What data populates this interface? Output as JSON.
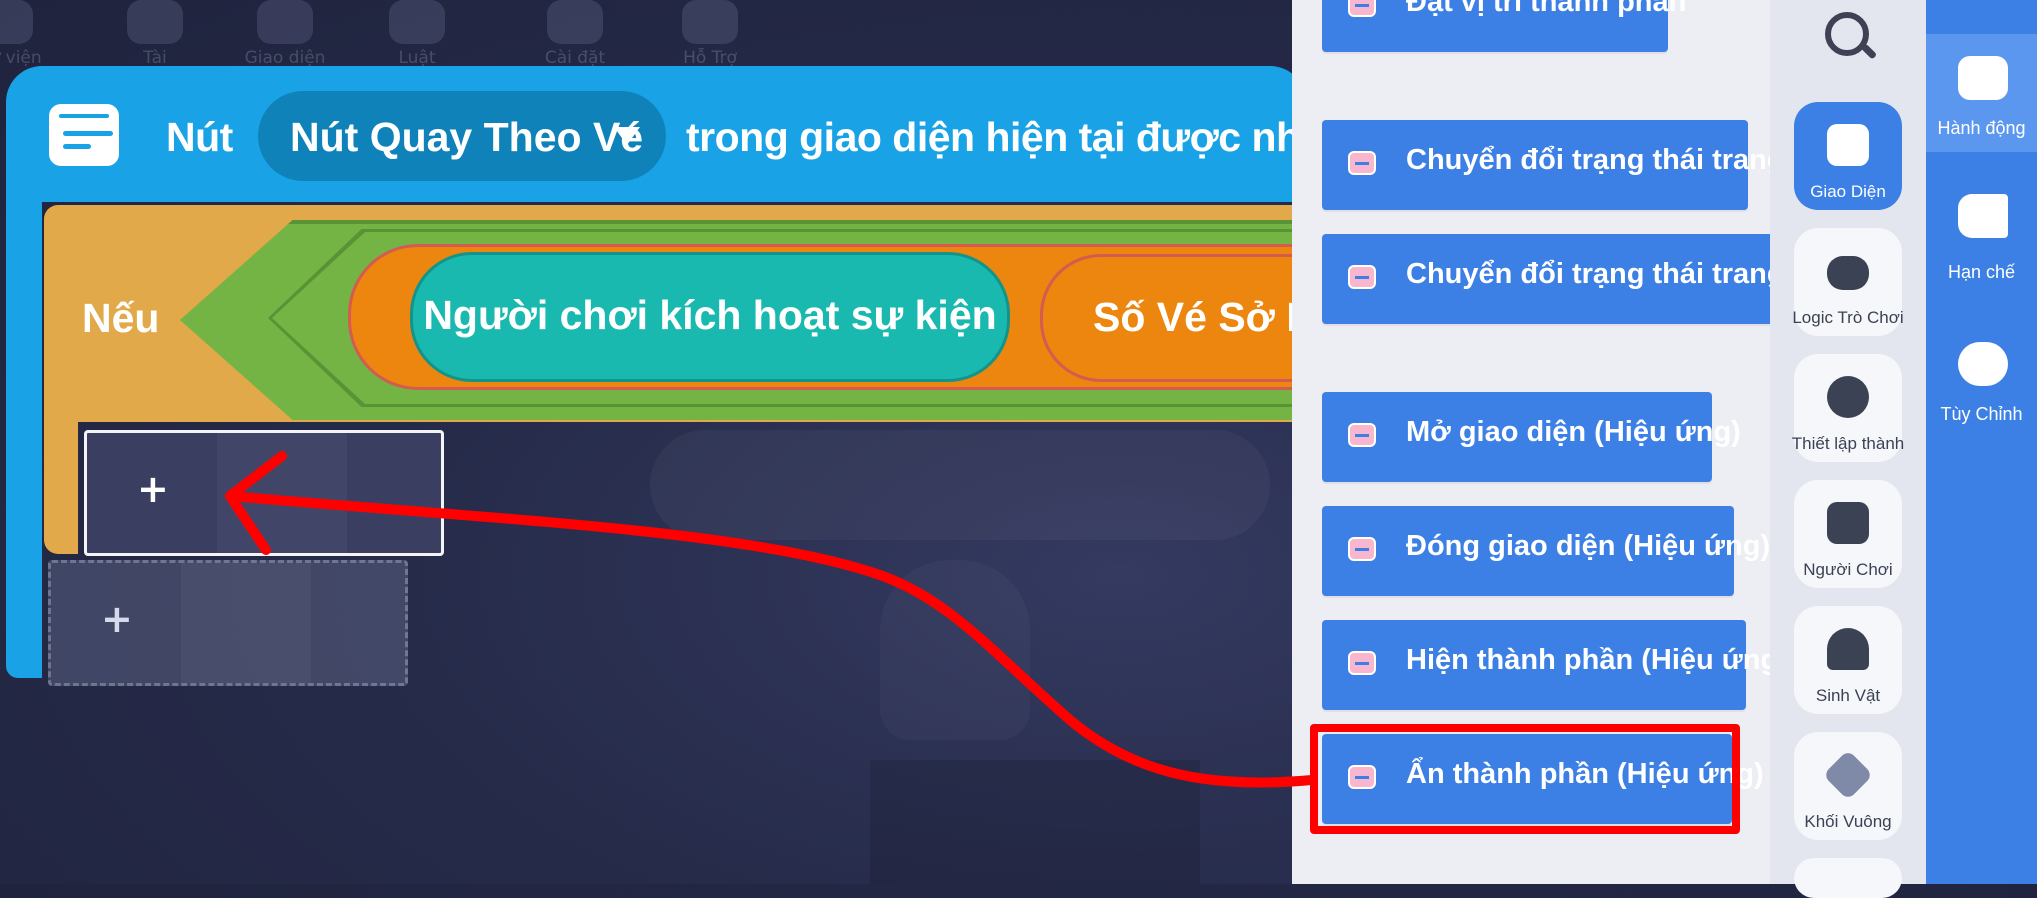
{
  "top_toolbar": {
    "items": [
      "Thư viện",
      "Tài Nguyên",
      "Giao diện",
      "Luật",
      "Cài đặt",
      "Hỗ Trợ"
    ]
  },
  "event_block": {
    "prefix": "Nút",
    "dropdown_value": "Nút Quay Theo Vé",
    "suffix": "trong giao diện hiện tại được nhấn"
  },
  "if_block": {
    "label": "Nếu",
    "condition_left": "Người chơi kích hoạt sự kiện",
    "condition_right": "Số Vé Sở Hữu"
  },
  "slots": {
    "plus_symbol": "+"
  },
  "block_list": {
    "items": [
      "Đặt vị trí thành phần",
      "Chuyển đổi trạng thái trang",
      "Chuyển đổi trạng thái trang (hoạt ảnh)",
      "Mở giao diện (Hiệu ứng)",
      "Đóng giao diện (Hiệu ứng)",
      "Hiện thành phần (Hiệu ứng)",
      "Ẩn thành phần (Hiệu ứng)"
    ],
    "highlighted_index": 6
  },
  "categories": [
    {
      "label": "Giao Diện",
      "icon": "window-icon",
      "active": true
    },
    {
      "label": "Logic Trò Chơi",
      "icon": "gamepad-icon",
      "active": false
    },
    {
      "label": "Thiết lập thành",
      "icon": "math-icon",
      "active": false
    },
    {
      "label": "Người Chơi",
      "icon": "robot-icon",
      "active": false
    },
    {
      "label": "Sinh Vật",
      "icon": "creature-icon",
      "active": false
    },
    {
      "label": "Khối Vuông",
      "icon": "cube-icon",
      "active": false
    }
  ],
  "side_nav": [
    {
      "label": "Hành động",
      "icon": "chat-block-icon",
      "active": true
    },
    {
      "label": "Hạn chế",
      "icon": "limit-icon",
      "active": false
    },
    {
      "label": "Tùy Chỉnh",
      "icon": "cloud-add-icon",
      "active": false
    }
  ],
  "colors": {
    "event_blue": "#19a3e6",
    "if_orange": "#e2a94a",
    "condition_green": "#74b444",
    "teal": "#1ab9b0",
    "action_blue": "#3c80e5",
    "annotation_red": "#ff0000"
  }
}
